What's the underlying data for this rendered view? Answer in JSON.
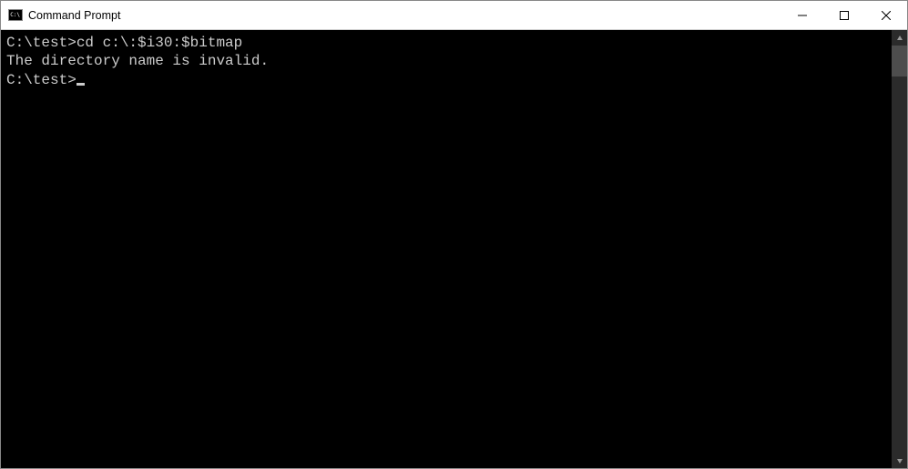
{
  "window": {
    "title": "Command Prompt"
  },
  "terminal": {
    "lines": [
      {
        "prompt": "C:\\test>",
        "cmd": "cd c:\\:$i30:$bitmap"
      },
      {
        "text": "The directory name is invalid."
      },
      {
        "text": ""
      },
      {
        "prompt": "C:\\test>",
        "cursor": true
      }
    ]
  },
  "colors": {
    "bg": "#000000",
    "fg": "#cccccc",
    "titlebar_bg": "#ffffff"
  }
}
